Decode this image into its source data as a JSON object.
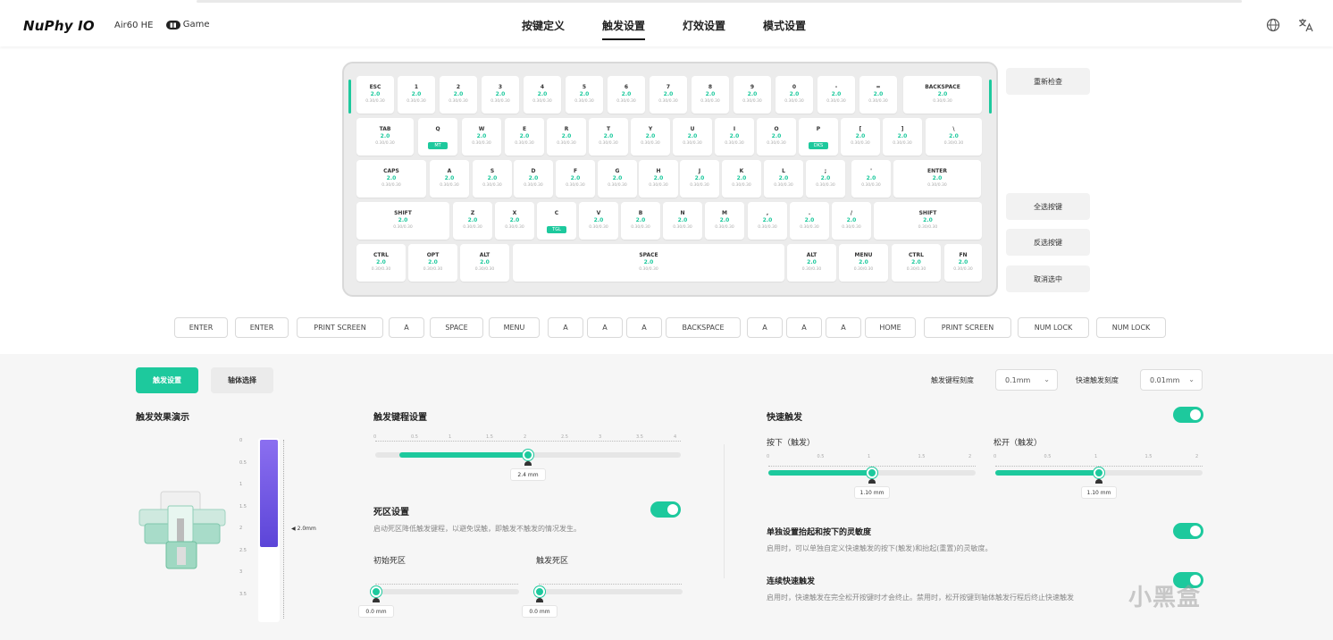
{
  "header": {
    "logo": "NuPhy IO",
    "device": "Air60 HE",
    "game_badge": "Game",
    "tabs": [
      {
        "label": "按键定义",
        "active": false
      },
      {
        "label": "触发设置",
        "active": true
      },
      {
        "label": "灯效设置",
        "active": false
      },
      {
        "label": "模式设置",
        "active": false
      }
    ],
    "icons": [
      "globe-icon",
      "translate-icon"
    ]
  },
  "keyboard": {
    "accent_color": "#1dc99d",
    "rows": [
      [
        {
          "l": "ESC",
          "v": "2.0",
          "s": "0.30/0.30"
        },
        {
          "l": "1",
          "v": "2.0",
          "s": "0.30/0.30"
        },
        {
          "l": "2",
          "v": "2.0",
          "s": "0.30/0.30"
        },
        {
          "l": "3",
          "v": "2.0",
          "s": "0.30/0.30"
        },
        {
          "l": "4",
          "v": "2.0",
          "s": "0.30/0.30"
        },
        {
          "l": "5",
          "v": "2.0",
          "s": "0.30/0.30"
        },
        {
          "l": "6",
          "v": "2.0",
          "s": "0.30/0.30"
        },
        {
          "l": "7",
          "v": "2.0",
          "s": "0.30/0.30"
        },
        {
          "l": "8",
          "v": "2.0",
          "s": "0.30/0.30"
        },
        {
          "l": "9",
          "v": "2.0",
          "s": "0.30/0.30"
        },
        {
          "l": "0",
          "v": "2.0",
          "s": "0.30/0.30"
        },
        {
          "l": "-",
          "v": "2.0",
          "s": "0.30/0.30"
        },
        {
          "l": "=",
          "v": "2.0",
          "s": "0.30/0.30"
        },
        {
          "l": "BACKSPACE",
          "v": "2.0",
          "s": "0.30/0.30"
        }
      ],
      [
        {
          "l": "TAB",
          "v": "2.0",
          "s": "0.30/0.30"
        },
        {
          "l": "Q",
          "t": "MT"
        },
        {
          "l": "W",
          "v": "2.0",
          "s": "0.30/0.30"
        },
        {
          "l": "E",
          "v": "2.0",
          "s": "0.30/0.30"
        },
        {
          "l": "R",
          "v": "2.0",
          "s": "0.30/0.30"
        },
        {
          "l": "T",
          "v": "2.0",
          "s": "0.30/0.30"
        },
        {
          "l": "Y",
          "v": "2.0",
          "s": "0.30/0.30"
        },
        {
          "l": "U",
          "v": "2.0",
          "s": "0.30/0.30"
        },
        {
          "l": "I",
          "v": "2.0",
          "s": "0.30/0.30"
        },
        {
          "l": "O",
          "v": "2.0",
          "s": "0.30/0.30"
        },
        {
          "l": "P",
          "t": "DKS"
        },
        {
          "l": "[",
          "v": "2.0",
          "s": "0.30/0.30"
        },
        {
          "l": "]",
          "v": "2.0",
          "s": "0.30/0.30"
        },
        {
          "l": "\\",
          "v": "2.0",
          "s": "0.30/0.30"
        }
      ],
      [
        {
          "l": "CAPS",
          "v": "2.0",
          "s": "0.30/0.30"
        },
        {
          "l": "A",
          "v": "2.0",
          "s": "0.30/0.30"
        },
        {
          "l": "S",
          "v": "2.0",
          "s": "0.30/0.30"
        },
        {
          "l": "D",
          "v": "2.0",
          "s": "0.30/0.30"
        },
        {
          "l": "F",
          "v": "2.0",
          "s": "0.30/0.30"
        },
        {
          "l": "G",
          "v": "2.0",
          "s": "0.30/0.30"
        },
        {
          "l": "H",
          "v": "2.0",
          "s": "0.30/0.30"
        },
        {
          "l": "J",
          "v": "2.0",
          "s": "0.30/0.30"
        },
        {
          "l": "K",
          "v": "2.0",
          "s": "0.30/0.30"
        },
        {
          "l": "L",
          "v": "2.0",
          "s": "0.30/0.30"
        },
        {
          "l": ";",
          "v": "2.0",
          "s": "0.30/0.30"
        },
        {
          "l": "'",
          "v": "2.0",
          "s": "0.30/0.30"
        },
        {
          "l": "ENTER",
          "v": "2.0",
          "s": "0.30/0.30"
        }
      ],
      [
        {
          "l": "SHIFT",
          "v": "2.0",
          "s": "0.30/0.30"
        },
        {
          "l": "Z",
          "v": "2.0",
          "s": "0.30/0.30"
        },
        {
          "l": "X",
          "v": "2.0",
          "s": "0.30/0.30"
        },
        {
          "l": "C",
          "t": "TGL"
        },
        {
          "l": "V",
          "v": "2.0",
          "s": "0.30/0.30"
        },
        {
          "l": "B",
          "v": "2.0",
          "s": "0.30/0.30"
        },
        {
          "l": "N",
          "v": "2.0",
          "s": "0.30/0.30"
        },
        {
          "l": "M",
          "v": "2.0",
          "s": "0.30/0.30"
        },
        {
          "l": ",",
          "v": "2.0",
          "s": "0.30/0.30"
        },
        {
          "l": ".",
          "v": "2.0",
          "s": "0.30/0.30"
        },
        {
          "l": "/",
          "v": "2.0",
          "s": "0.30/0.30"
        },
        {
          "l": "SHIFT",
          "v": "2.0",
          "s": "0.30/0.30"
        }
      ],
      [
        {
          "l": "CTRL",
          "v": "2.0",
          "s": "0.30/0.30"
        },
        {
          "l": "OPT",
          "v": "2.0",
          "s": "0.30/0.30"
        },
        {
          "l": "ALT",
          "v": "2.0",
          "s": "0.30/0.30"
        },
        {
          "l": "SPACE",
          "v": "2.0",
          "s": "0.30/0.30"
        },
        {
          "l": "ALT",
          "v": "2.0",
          "s": "0.30/0.30"
        },
        {
          "l": "MENU",
          "v": "2.0",
          "s": "0.30/0.30"
        },
        {
          "l": "CTRL",
          "v": "2.0",
          "s": "0.30/0.30"
        },
        {
          "l": "FN",
          "v": "2.0",
          "s": "0.30/0.30"
        }
      ]
    ]
  },
  "side_buttons": [
    "重新检查",
    "全选按键",
    "反选按键",
    "取消选中"
  ],
  "bindings": [
    "ENTER",
    "ENTER",
    "PRINT SCREEN",
    "A",
    "SPACE",
    "MENU",
    "A",
    "A",
    "A",
    "BACKSPACE",
    "A",
    "A",
    "A",
    "HOME",
    "PRINT SCREEN",
    "NUM LOCK",
    "NUM LOCK"
  ],
  "panel": {
    "segments": {
      "active": "触发设置",
      "inactive": "轴体选择"
    },
    "trigger_precision": {
      "label": "触发键程刻度",
      "value": "0.1mm"
    },
    "rapid_precision": {
      "label": "快速触发刻度",
      "value": "0.01mm"
    },
    "demo": {
      "title": "触发效果演示",
      "ticks": [
        "0",
        "0.5",
        "1",
        "1.5",
        "2",
        "2.5",
        "3",
        "3.5"
      ],
      "value_label": "2.0mm",
      "level_fraction": 0.6
    },
    "trigger_travel": {
      "title": "触发键程设置",
      "value_label": "2.4 mm",
      "fraction": 0.5,
      "ticks": [
        "0",
        "0.5",
        "1",
        "1.5",
        "2",
        "2.5",
        "3",
        "3.5",
        "4"
      ]
    },
    "deadzone": {
      "title": "死区设置",
      "desc": "启动死区降低触发键程，以避免误触，即触发不触发的情况发生。",
      "enabled": true,
      "initial": {
        "label": "初始死区",
        "value_label": "0.0 mm",
        "fraction": 0
      },
      "bottom": {
        "label": "触发死区",
        "value_label": "0.0 mm",
        "fraction": 0
      }
    },
    "rapid": {
      "title": "快速触发",
      "enabled": true,
      "press": {
        "label": "按下（触发）",
        "value_label": "1.10 mm",
        "fraction": 0.5
      },
      "release": {
        "label": "松开（触发）",
        "value_label": "1.10 mm",
        "fraction": 0.5
      },
      "ticks": [
        "0",
        "0.5",
        "1",
        "1.5",
        "2"
      ],
      "separate": {
        "title": "单独设置抬起和按下的灵敏度",
        "desc": "启用时，可以单独自定义快速触发的按下(触发)和抬起(重置)的灵敏度。",
        "enabled": true
      },
      "continuous": {
        "title": "连续快速触发",
        "desc": "启用时，快速触发在完全松开按键时才会终止。禁用时，松开按键到轴体触发行程后终止快速触发",
        "enabled": true
      }
    }
  },
  "watermark": "小黑盒"
}
